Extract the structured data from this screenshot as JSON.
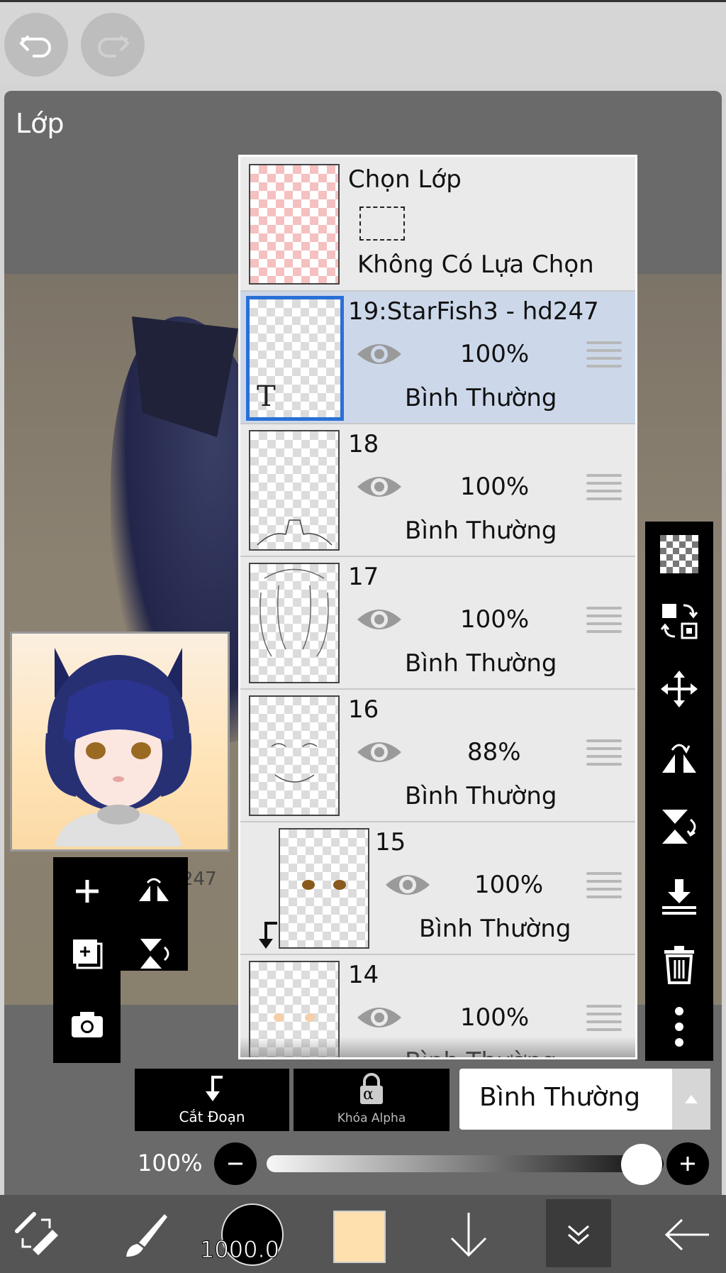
{
  "top": {
    "undo_icon": "undo-icon",
    "redo_icon": "redo-icon"
  },
  "panel": {
    "title": "Lớp"
  },
  "canvas": {
    "signature_text": "247"
  },
  "layers": [
    {
      "name": "Chọn Lớp",
      "selection_status": "Không Có Lựa Chọn",
      "thumb": "pink-checker"
    },
    {
      "name": "19:StarFish3 - hd247",
      "opacity": "100%",
      "mode": "Bình Thường",
      "selected": true,
      "type_badge": "T"
    },
    {
      "name": "18",
      "opacity": "100%",
      "mode": "Bình Thường"
    },
    {
      "name": "17",
      "opacity": "100%",
      "mode": "Bình Thường"
    },
    {
      "name": "16",
      "opacity": "88%",
      "mode": "Bình Thường"
    },
    {
      "name": "15",
      "opacity": "100%",
      "mode": "Bình Thường",
      "clipped": true
    },
    {
      "name": "14",
      "opacity": "100%",
      "mode": "Bình Thường"
    }
  ],
  "actions": {
    "clip_label": "Cắt Đoạn",
    "alpha_lock_label": "Khóa Alpha",
    "alpha_glyph": "α",
    "blend_mode": "Bình Thường"
  },
  "opacity": {
    "label": "100%",
    "value": 1.0
  },
  "bottom": {
    "brush_size": "1000.0",
    "color": "#fde0ad"
  },
  "colors": {
    "selected_border": "#2a6fd6",
    "selected_row": "#ccd8ea",
    "toolbar": "#000000"
  }
}
